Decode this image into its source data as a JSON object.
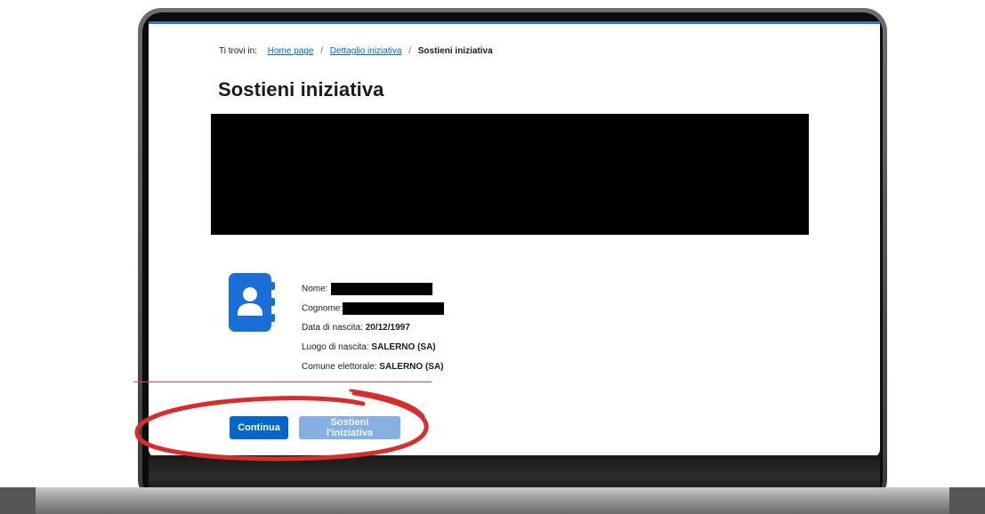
{
  "breadcrumb": {
    "prefix": "Ti trovi in:",
    "items": [
      "Home page",
      "Dettaglio iniziativa"
    ],
    "separator": "/",
    "current": "Sostieni iniziativa"
  },
  "page": {
    "title": "Sostieni iniziativa"
  },
  "profile": {
    "name_label": "Nome:",
    "surname_label": "Cognome:",
    "birth_date_label": "Data di nascita:",
    "birth_date_value": "20/12/1997",
    "birth_place_label": "Luogo di nascita:",
    "birth_place_value": "SALERNO (SA)",
    "electoral_municipality_label": "Comune elettorale:",
    "electoral_municipality_value": "SALERNO (SA)"
  },
  "actions": {
    "continue_label": "Continua",
    "support_label": "Sostieni l'iniziativa",
    "support_enabled": false
  },
  "colors": {
    "primary": "#0066cc",
    "primary_disabled": "#86b0e2",
    "annotation_red": "#d62d2d",
    "icon_blue": "#1a6ed8"
  },
  "icons": {
    "profile": "contact-book-icon"
  }
}
